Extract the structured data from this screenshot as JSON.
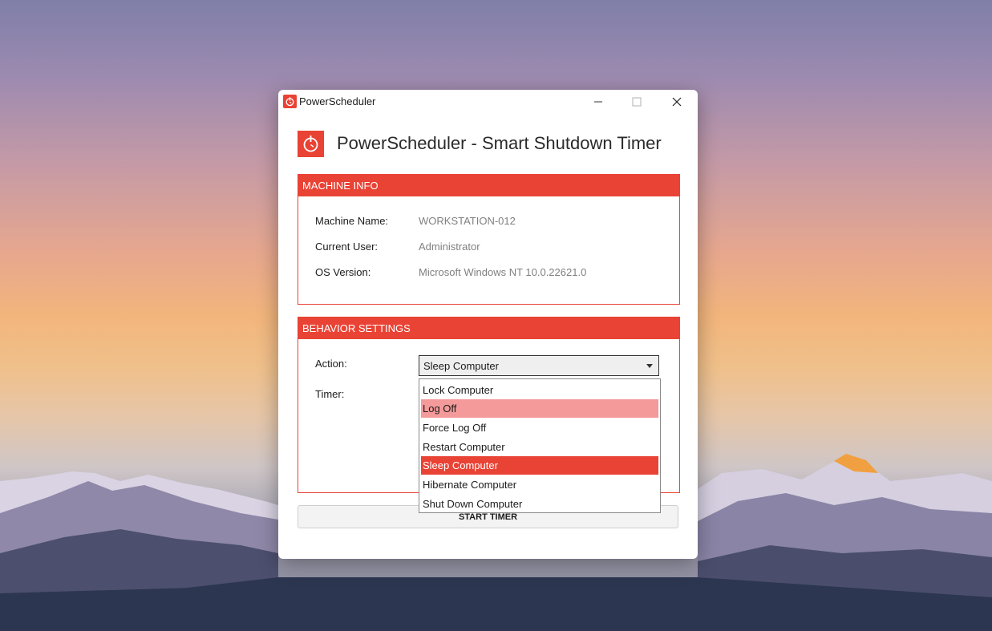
{
  "window": {
    "title": "PowerScheduler",
    "heading": "PowerScheduler - Smart Shutdown Timer"
  },
  "machine_info": {
    "header": "MACHINE INFO",
    "rows": [
      {
        "label": "Machine Name:",
        "value": "WORKSTATION-012"
      },
      {
        "label": "Current User:",
        "value": "Administrator"
      },
      {
        "label": "OS Version:",
        "value": "Microsoft Windows NT 10.0.22621.0"
      }
    ]
  },
  "behavior": {
    "header": "BEHAVIOR SETTINGS",
    "action_label": "Action:",
    "action_selected": "Sleep Computer",
    "timer_label": "Timer:",
    "options": [
      "Lock Computer",
      "Log Off",
      "Force Log Off",
      "Restart Computer",
      "Sleep Computer",
      "Hibernate Computer",
      "Shut Down Computer"
    ],
    "hovered_option": "Log Off"
  },
  "start_button": "START TIMER",
  "colors": {
    "accent": "#e94335",
    "hover": "#f59a9a"
  }
}
